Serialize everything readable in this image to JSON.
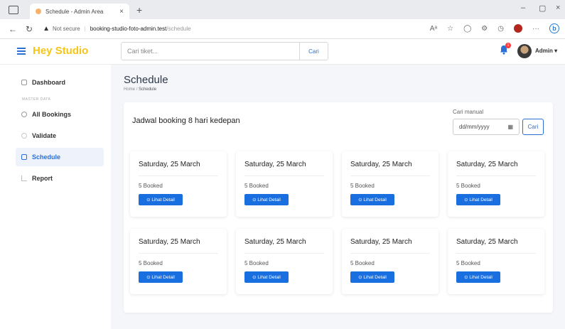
{
  "browser": {
    "tab_title": "Schedule - Admin Area",
    "tab_close": "×",
    "new_tab": "+",
    "not_secure": "Not secure",
    "url_host": "booking-studio-foto-admin.test",
    "url_path": "/schedule",
    "window_min": "–",
    "window_restore": "▢",
    "window_close": "×"
  },
  "app": {
    "brand": "Hey Studio",
    "search_placeholder": "Cari tiket...",
    "search_button": "Cari",
    "notification_count": "1",
    "user_name": "Admin ▾",
    "accent_color": "#2b6fd6",
    "brand_color": "#f5c518"
  },
  "sidebar": {
    "items": [
      {
        "label": "Dashboard",
        "icon": "grid-icon"
      },
      {
        "label": "All Bookings",
        "icon": "settings-icon"
      },
      {
        "label": "Validate",
        "icon": "check-icon"
      },
      {
        "label": "Schedule",
        "icon": "calendar-icon"
      },
      {
        "label": "Report",
        "icon": "chart-icon"
      }
    ],
    "section_label": "MASTER DATA"
  },
  "page": {
    "title": "Schedule",
    "breadcrumb_home": "Home",
    "breadcrumb_sep": "/",
    "breadcrumb_current": "Schedule"
  },
  "schedule": {
    "heading": "Jadwal booking 8 hari kedepan",
    "manual_label": "Cari manual",
    "date_placeholder": "dd/mm/yyyy",
    "manual_button": "Cari",
    "days": [
      {
        "date": "Saturday, 25 March",
        "booked": "5 Booked",
        "button": "⊙ Lihat Detail"
      },
      {
        "date": "Saturday, 25 March",
        "booked": "5 Booked",
        "button": "⊙ Lihat Detail"
      },
      {
        "date": "Saturday, 25 March",
        "booked": "5 Booked",
        "button": "⊙ Lihat Detail"
      },
      {
        "date": "Saturday, 25 March",
        "booked": "5 Booked",
        "button": "⊙ Lihat Detail"
      },
      {
        "date": "Saturday, 25 March",
        "booked": "5 Booked",
        "button": "⊙ Lihat Detail"
      },
      {
        "date": "Saturday, 25 March",
        "booked": "5 Booked",
        "button": "⊙ Lihat Detail"
      },
      {
        "date": "Saturday, 25 March",
        "booked": "5 Booked",
        "button": "⊙ Lihat Detail"
      },
      {
        "date": "Saturday, 25 March",
        "booked": "5 Booked",
        "button": "⊙ Lihat Detail"
      }
    ]
  }
}
